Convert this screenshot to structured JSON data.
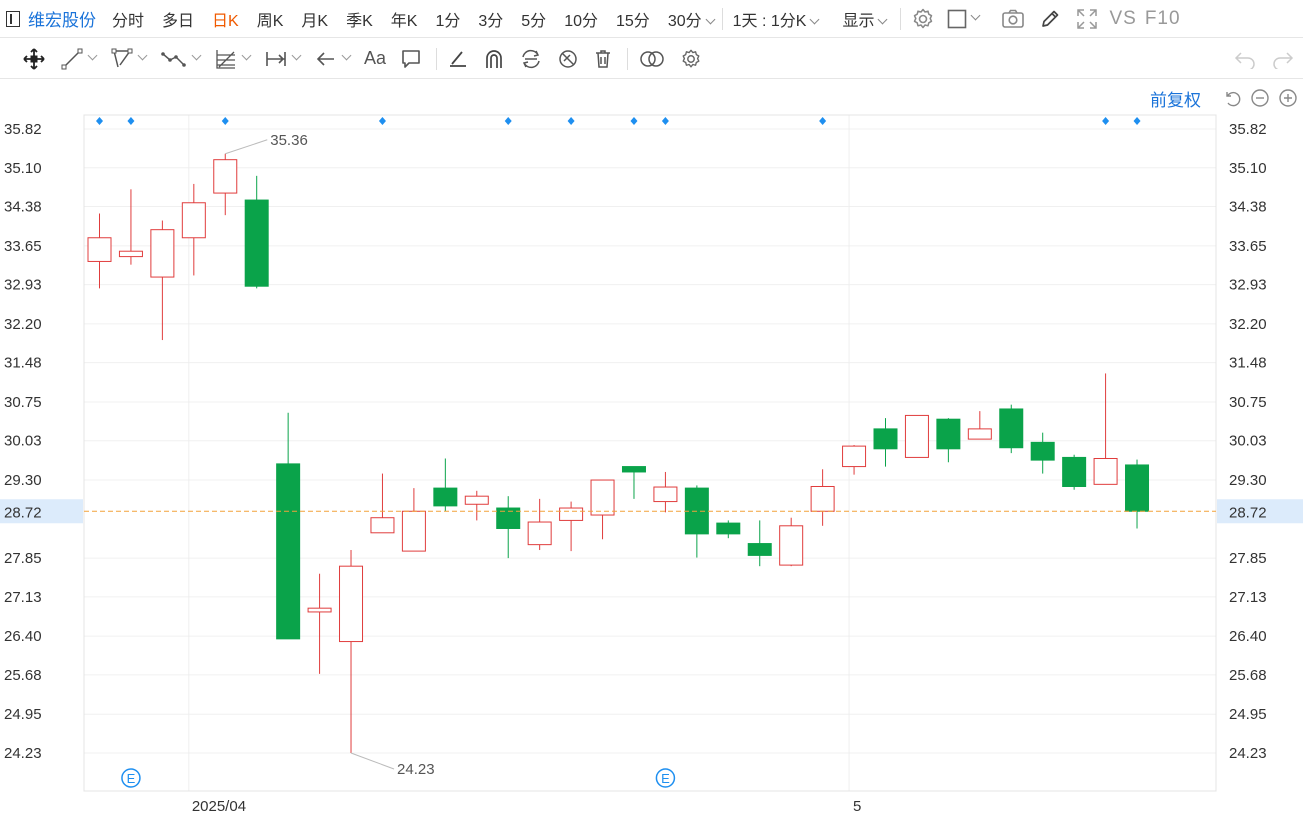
{
  "topbar": {
    "stock_name": "维宏股份",
    "periods": [
      "分时",
      "多日",
      "日K",
      "周K",
      "月K",
      "季K",
      "年K",
      "1分",
      "3分",
      "5分",
      "10分",
      "15分",
      "30分"
    ],
    "active_period": "日K",
    "interval_label": "1天 : 1分K",
    "display_label": "显示",
    "vs_label": "VS",
    "f10_label": "F10"
  },
  "toolbar": {
    "text_tool_label": "Aa"
  },
  "adjust_label": "前复权",
  "colors": {
    "up": "#e03c3c",
    "down": "#0aa34a",
    "current_line": "#f2a23a",
    "current_bg": "#dcebfb",
    "accent": "#1a73d9",
    "marker": "#1e8ff0"
  },
  "chart_data": {
    "type": "candlestick",
    "y_ticks": [
      "35.82",
      "35.10",
      "34.38",
      "33.65",
      "32.93",
      "32.20",
      "31.48",
      "30.75",
      "30.03",
      "29.30",
      "28.72",
      "27.85",
      "27.13",
      "26.40",
      "25.68",
      "24.95",
      "24.23"
    ],
    "x_labels": [
      "2025/04",
      "5"
    ],
    "current_price": "28.72",
    "max_label": "35.36",
    "min_label": "24.23",
    "event_label": "E",
    "candles": [
      {
        "o": 33.36,
        "h": 34.25,
        "l": 32.86,
        "c": 33.8
      },
      {
        "o": 33.45,
        "h": 34.7,
        "l": 33.3,
        "c": 33.55
      },
      {
        "o": 33.07,
        "h": 34.12,
        "l": 31.9,
        "c": 33.95
      },
      {
        "o": 33.8,
        "h": 34.8,
        "l": 33.1,
        "c": 34.45
      },
      {
        "o": 34.63,
        "h": 35.36,
        "l": 34.22,
        "c": 35.25
      },
      {
        "o": 34.5,
        "h": 34.95,
        "l": 32.86,
        "c": 32.9
      },
      {
        "o": 29.6,
        "h": 30.55,
        "l": 26.4,
        "c": 26.35
      },
      {
        "o": 26.85,
        "h": 27.56,
        "l": 25.7,
        "c": 26.92
      },
      {
        "o": 26.3,
        "h": 28.0,
        "l": 24.23,
        "c": 27.7
      },
      {
        "o": 28.32,
        "h": 29.42,
        "l": 28.32,
        "c": 28.6
      },
      {
        "o": 27.98,
        "h": 29.15,
        "l": 27.98,
        "c": 28.72
      },
      {
        "o": 29.15,
        "h": 29.7,
        "l": 28.72,
        "c": 28.82
      },
      {
        "o": 28.85,
        "h": 29.1,
        "l": 28.55,
        "c": 29.0
      },
      {
        "o": 28.78,
        "h": 29.0,
        "l": 27.85,
        "c": 28.4
      },
      {
        "o": 28.1,
        "h": 28.95,
        "l": 28.0,
        "c": 28.52
      },
      {
        "o": 28.55,
        "h": 28.9,
        "l": 27.98,
        "c": 28.78
      },
      {
        "o": 28.65,
        "h": 29.3,
        "l": 28.2,
        "c": 29.3
      },
      {
        "o": 29.55,
        "h": 29.55,
        "l": 28.95,
        "c": 29.45
      },
      {
        "o": 28.9,
        "h": 29.45,
        "l": 28.7,
        "c": 29.17
      },
      {
        "o": 29.15,
        "h": 29.2,
        "l": 27.86,
        "c": 28.3
      },
      {
        "o": 28.5,
        "h": 28.55,
        "l": 28.22,
        "c": 28.3
      },
      {
        "o": 28.12,
        "h": 28.55,
        "l": 27.7,
        "c": 27.9
      },
      {
        "o": 27.72,
        "h": 28.6,
        "l": 27.7,
        "c": 28.45
      },
      {
        "o": 28.72,
        "h": 29.5,
        "l": 28.45,
        "c": 29.18
      },
      {
        "o": 29.55,
        "h": 29.95,
        "l": 29.4,
        "c": 29.93
      },
      {
        "o": 30.25,
        "h": 30.45,
        "l": 29.55,
        "c": 29.88
      },
      {
        "o": 29.72,
        "h": 30.5,
        "l": 29.72,
        "c": 30.5
      },
      {
        "o": 30.43,
        "h": 30.45,
        "l": 29.63,
        "c": 29.88
      },
      {
        "o": 30.06,
        "h": 30.58,
        "l": 30.06,
        "c": 30.25
      },
      {
        "o": 30.62,
        "h": 30.7,
        "l": 29.8,
        "c": 29.9
      },
      {
        "o": 30.0,
        "h": 30.18,
        "l": 29.42,
        "c": 29.67
      },
      {
        "o": 29.72,
        "h": 29.77,
        "l": 29.12,
        "c": 29.18
      },
      {
        "o": 29.22,
        "h": 31.28,
        "l": 29.22,
        "c": 29.7
      },
      {
        "o": 29.58,
        "h": 29.68,
        "l": 28.4,
        "c": 28.72
      }
    ],
    "event_candle_indexes": [
      1,
      18
    ],
    "blue_marker_candle_indexes": [
      0,
      1,
      4,
      9,
      13,
      15,
      17,
      18,
      23,
      32,
      33
    ],
    "x_label_candle_indexes": [
      3,
      24
    ]
  }
}
